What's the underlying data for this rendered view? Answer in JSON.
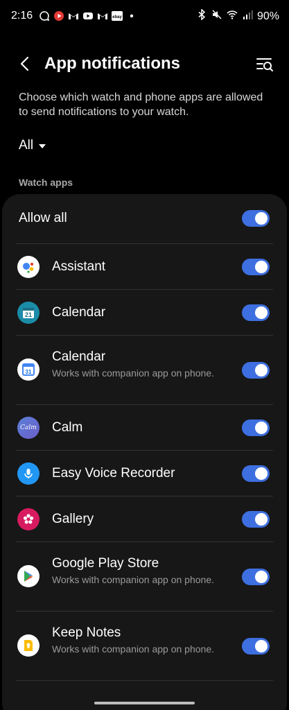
{
  "status_bar": {
    "time": "2:16",
    "battery": "90%",
    "left_icons": [
      "chat-icon",
      "youtube-icon",
      "gmail-icon",
      "youtube-icon",
      "gmail-icon",
      "ebay-icon",
      "dot-icon"
    ],
    "right_icons": [
      "bluetooth-icon",
      "mute-icon",
      "wifi-icon",
      "signal-icon"
    ]
  },
  "header": {
    "title": "App notifications"
  },
  "description": "Choose which watch and phone apps are allowed to send notifications to your watch.",
  "filter": {
    "selected": "All"
  },
  "section": {
    "label": "Watch apps"
  },
  "allow_all": {
    "label": "Allow all",
    "enabled": true
  },
  "apps": [
    {
      "name": "Assistant",
      "subtitle": "",
      "enabled": true,
      "icon": "google-assistant-icon"
    },
    {
      "name": "Calendar",
      "subtitle": "",
      "enabled": true,
      "icon": "samsung-calendar-icon",
      "icon_text": "21"
    },
    {
      "name": "Calendar",
      "subtitle": "Works with companion app on phone.",
      "enabled": true,
      "icon": "google-calendar-icon",
      "icon_text": "31"
    },
    {
      "name": "Calm",
      "subtitle": "",
      "enabled": true,
      "icon": "calm-icon",
      "icon_text": "Calm"
    },
    {
      "name": "Easy Voice Recorder",
      "subtitle": "",
      "enabled": true,
      "icon": "microphone-icon"
    },
    {
      "name": "Gallery",
      "subtitle": "",
      "enabled": true,
      "icon": "gallery-flower-icon"
    },
    {
      "name": "Google Play Store",
      "subtitle": "Works with companion app on phone.",
      "enabled": true,
      "icon": "play-store-icon"
    },
    {
      "name": "Keep Notes",
      "subtitle": "Works with companion app on phone.",
      "enabled": true,
      "icon": "keep-notes-icon"
    }
  ],
  "colors": {
    "background": "#000000",
    "card": "#171717",
    "toggle_on": "#3e6fe0",
    "secondary_text": "#9a9a9a"
  }
}
